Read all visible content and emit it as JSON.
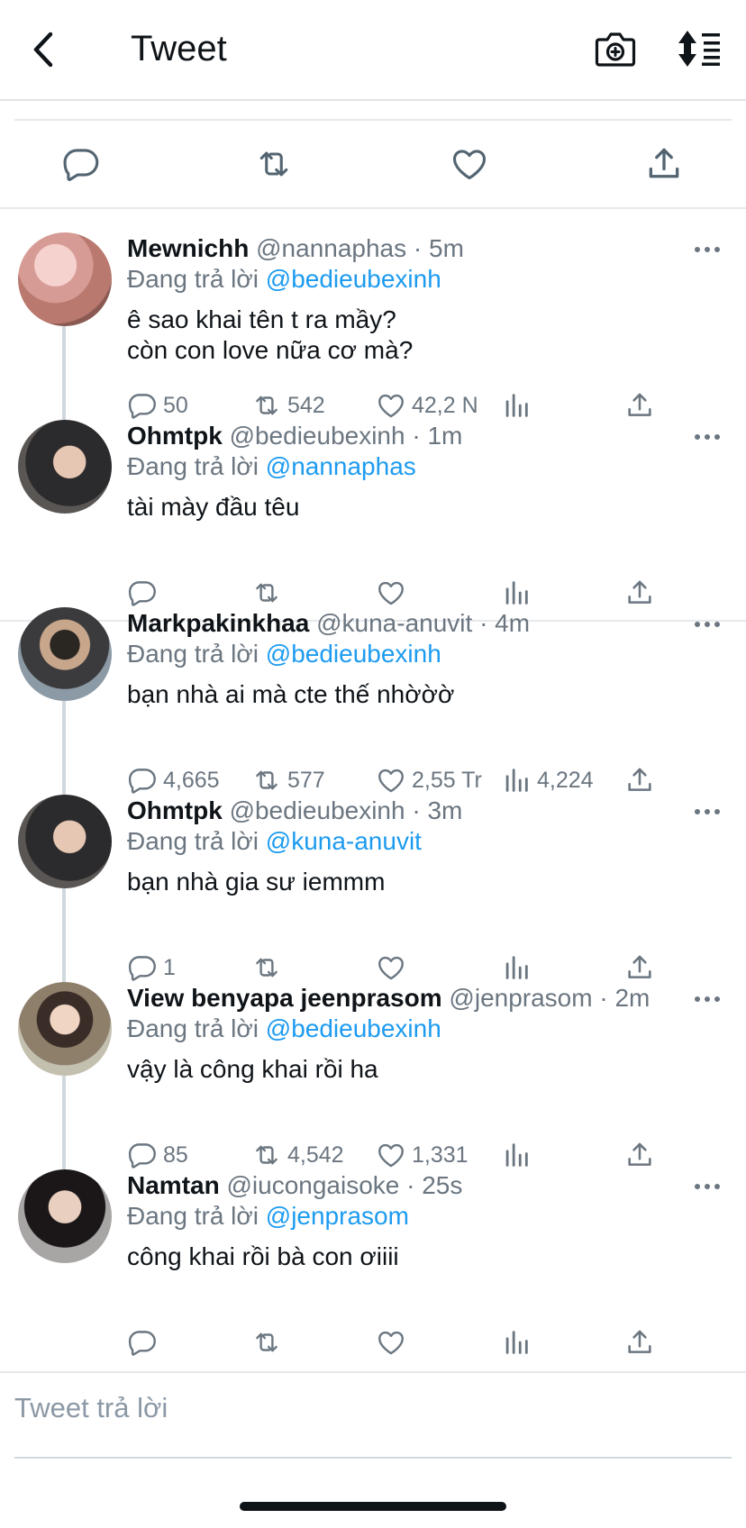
{
  "header": {
    "title": "Tweet"
  },
  "icons": {
    "back": "chevron-left-icon",
    "camera": "camera-plus-icon",
    "sort": "sort-icon",
    "reply": "reply-icon",
    "retweet": "retweet-icon",
    "like": "heart-icon",
    "views": "views-icon",
    "share": "share-icon",
    "more": "more-icon"
  },
  "colors": {
    "accent": "#1d9bf0",
    "muted": "#6b7680"
  },
  "replies": [
    {
      "name": "Mewnichh",
      "handle": "@nannaphas · 5m",
      "replying_label": "Đang trả lời",
      "replying_to": "@bedieubexinh",
      "text": "ê sao khai tên t ra mầy?\ncòn con love nữa cơ mà?",
      "replies": "50",
      "retweets": "542",
      "likes": "42,2 N",
      "views": ""
    },
    {
      "name": "Ohmtpk",
      "handle": "@bedieubexinh · 1m",
      "replying_label": "Đang trả lời",
      "replying_to": "@nannaphas",
      "text": "tài mày đầu têu",
      "replies": "",
      "retweets": "",
      "likes": "",
      "views": ""
    },
    {
      "name": "Markpakinkhaa",
      "handle": "@kuna-anuvit · 4m",
      "replying_label": "Đang trả lời",
      "replying_to": "@bedieubexinh",
      "text": "bạn nhà ai mà cte thế nhờờờ",
      "replies": "4,665",
      "retweets": "577",
      "likes": "2,55 Tr",
      "views": "4,224"
    },
    {
      "name": "Ohmtpk",
      "handle": "@bedieubexinh · 3m",
      "replying_label": "Đang trả lời",
      "replying_to": "@kuna-anuvit",
      "text": "bạn nhà gia sư iemmm",
      "replies": "1",
      "retweets": "",
      "likes": "",
      "views": ""
    },
    {
      "name": "View benyapa jeenprasom",
      "handle": "@jenprasom · 2m",
      "replying_label": "Đang trả lời",
      "replying_to": "@bedieubexinh",
      "text": "vậy là công khai rồi ha",
      "replies": "85",
      "retweets": "4,542",
      "likes": "1,331",
      "views": ""
    },
    {
      "name": "Namtan",
      "handle": "@iucongaisoke · 25s",
      "replying_label": "Đang trả lời",
      "replying_to": "@jenprasom",
      "text": "công khai rồi bà con ơiiii",
      "replies": "",
      "retweets": "",
      "likes": "",
      "views": ""
    }
  ],
  "composer": {
    "placeholder": "Tweet trả lời"
  }
}
